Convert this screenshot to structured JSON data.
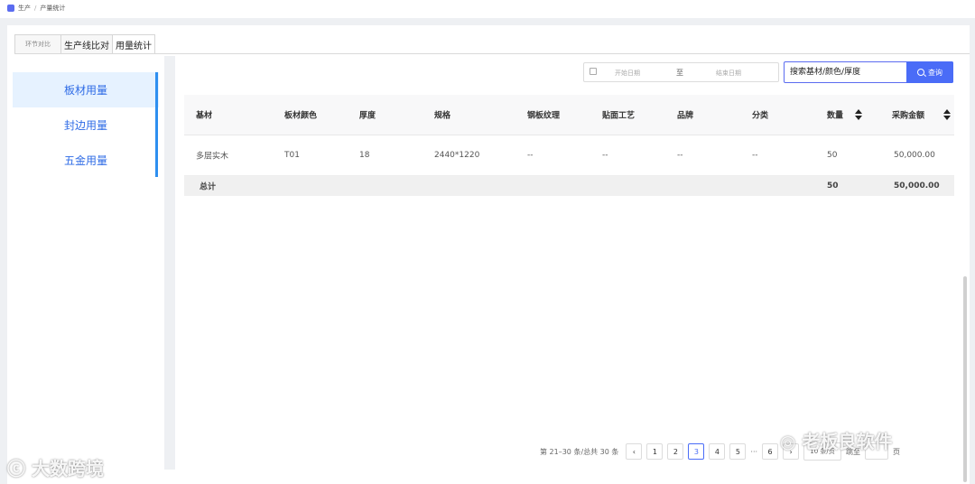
{
  "breadcrumb": {
    "items": [
      "生产",
      "产量统计"
    ]
  },
  "tabs": [
    {
      "label": "环节对比"
    },
    {
      "label": "生产线比对"
    },
    {
      "label": "用量统计"
    }
  ],
  "sidebar": {
    "items": [
      {
        "label": "板材用量"
      },
      {
        "label": "封边用量"
      },
      {
        "label": "五金用量"
      }
    ]
  },
  "filters": {
    "start_placeholder": "开始日期",
    "separator": "至",
    "end_placeholder": "结束日期",
    "search_placeholder": "搜索基材/颜色/厚度",
    "search_button": "查询"
  },
  "table": {
    "columns": [
      "基材",
      "板材颜色",
      "厚度",
      "规格",
      "钢板纹理",
      "贴面工艺",
      "品牌",
      "分类",
      "数量",
      "采购金额"
    ],
    "rows": [
      [
        "多层实木",
        "T01",
        "18",
        "2440*1220",
        "--",
        "--",
        "--",
        "--",
        "50",
        "50,000.00"
      ]
    ],
    "total": {
      "label": "总计",
      "quantity": "50",
      "amount": "50,000.00"
    }
  },
  "pagination": {
    "summary": "第 21–30 条/总共 30 条",
    "pages": [
      "1",
      "2",
      "3",
      "4",
      "5"
    ],
    "current": "3",
    "ellipsis": "···",
    "last_page": "6",
    "page_size": "10 条/页",
    "goto_label": "跳至",
    "goto_suffix": "页"
  },
  "watermarks": {
    "left": "大数跨境",
    "right": "老板良软件"
  }
}
